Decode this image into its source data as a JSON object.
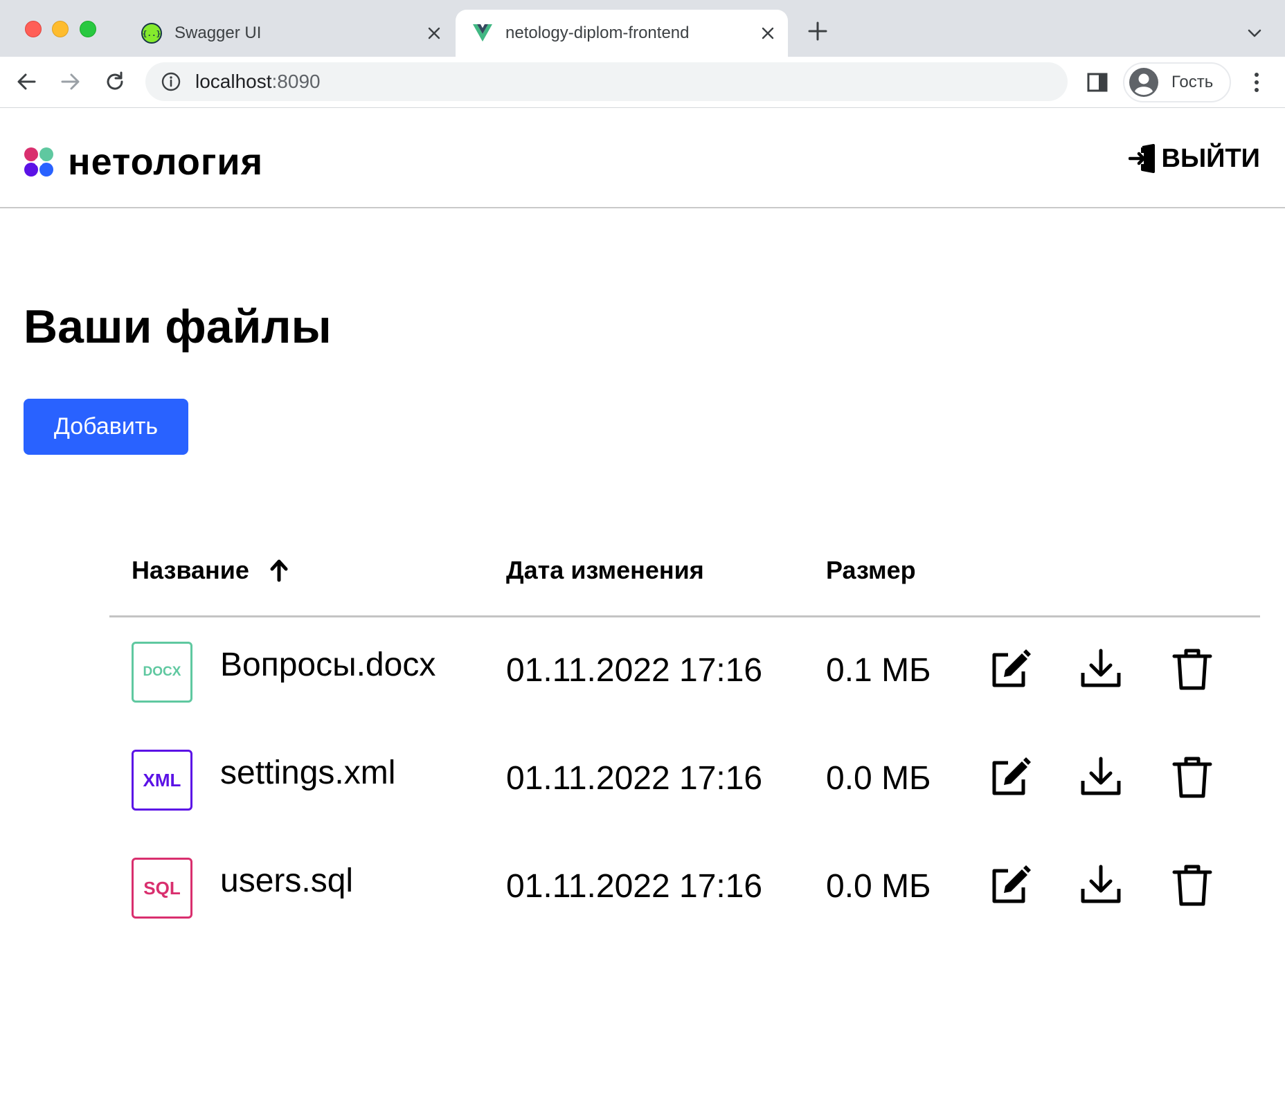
{
  "browser": {
    "tabs": [
      {
        "title": "Swagger UI",
        "icon": "swagger-icon",
        "active": false
      },
      {
        "title": "netology-diplom-frontend",
        "icon": "vue-icon",
        "active": true
      }
    ],
    "url_host": "localhost",
    "url_port": ":8090",
    "profile_label": "Гость"
  },
  "header": {
    "logo_text": "нетология",
    "logout_label": "ВЫЙТИ"
  },
  "main": {
    "title": "Ваши файлы",
    "add_button_label": "Добавить"
  },
  "table": {
    "columns": {
      "name": "Название",
      "date": "Дата изменения",
      "size": "Размер"
    },
    "sort": {
      "column": "name",
      "direction": "asc"
    },
    "rows": [
      {
        "ext": "DOCX",
        "ext_color": "#5fc8a0",
        "name": "Вопросы.docx",
        "date": "01.11.2022 17:16",
        "size": "0.1 МБ"
      },
      {
        "ext": "XML",
        "ext_color": "#5b12e6",
        "name": "settings.xml",
        "date": "01.11.2022 17:16",
        "size": "0.0 МБ"
      },
      {
        "ext": "SQL",
        "ext_color": "#d92f6e",
        "name": "users.sql",
        "date": "01.11.2022 17:16",
        "size": "0.0 МБ"
      }
    ]
  },
  "colors": {
    "accent": "#2962ff",
    "logo_dots": [
      "#d92f6e",
      "#5fc8a0",
      "#5b12e6",
      "#2962ff"
    ]
  }
}
